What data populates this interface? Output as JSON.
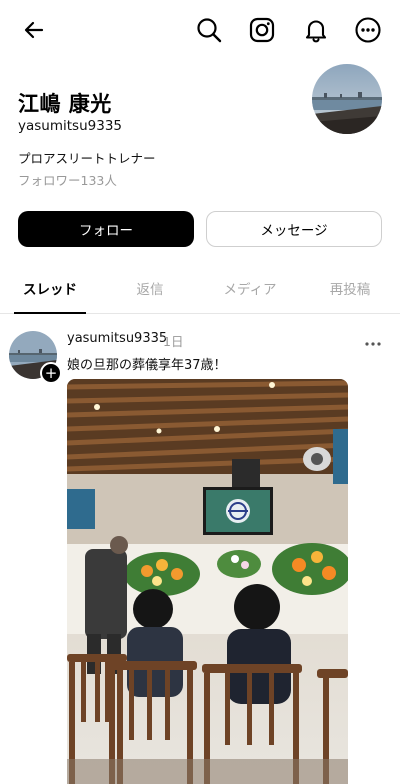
{
  "header": {
    "back_icon": "arrow-left-icon",
    "search_icon": "search-icon",
    "instagram_icon": "instagram-icon",
    "notification_icon": "bell-icon",
    "more_icon": "more-circle-icon"
  },
  "profile": {
    "display_name": "江嶋 康光",
    "username": "yasumitsu9335",
    "bio": "プロアスリートトレナー",
    "followers": "フォロワー133人"
  },
  "actions": {
    "follow_label": "フォロー",
    "message_label": "メッセージ"
  },
  "tabs": [
    {
      "label": "スレッド",
      "active": true
    },
    {
      "label": "返信",
      "active": false
    },
    {
      "label": "メディア",
      "active": false
    },
    {
      "label": "再投稿",
      "active": false
    }
  ],
  "post": {
    "username": "yasumitsu9335",
    "time": "1日",
    "text": "娘の旦那の葬儀享年37歳！",
    "follow_badge": "+"
  },
  "colors": {
    "primary": "#000000",
    "muted": "#999999",
    "inactive_tab": "#a8a8a8",
    "border": "#cfcfcf"
  }
}
